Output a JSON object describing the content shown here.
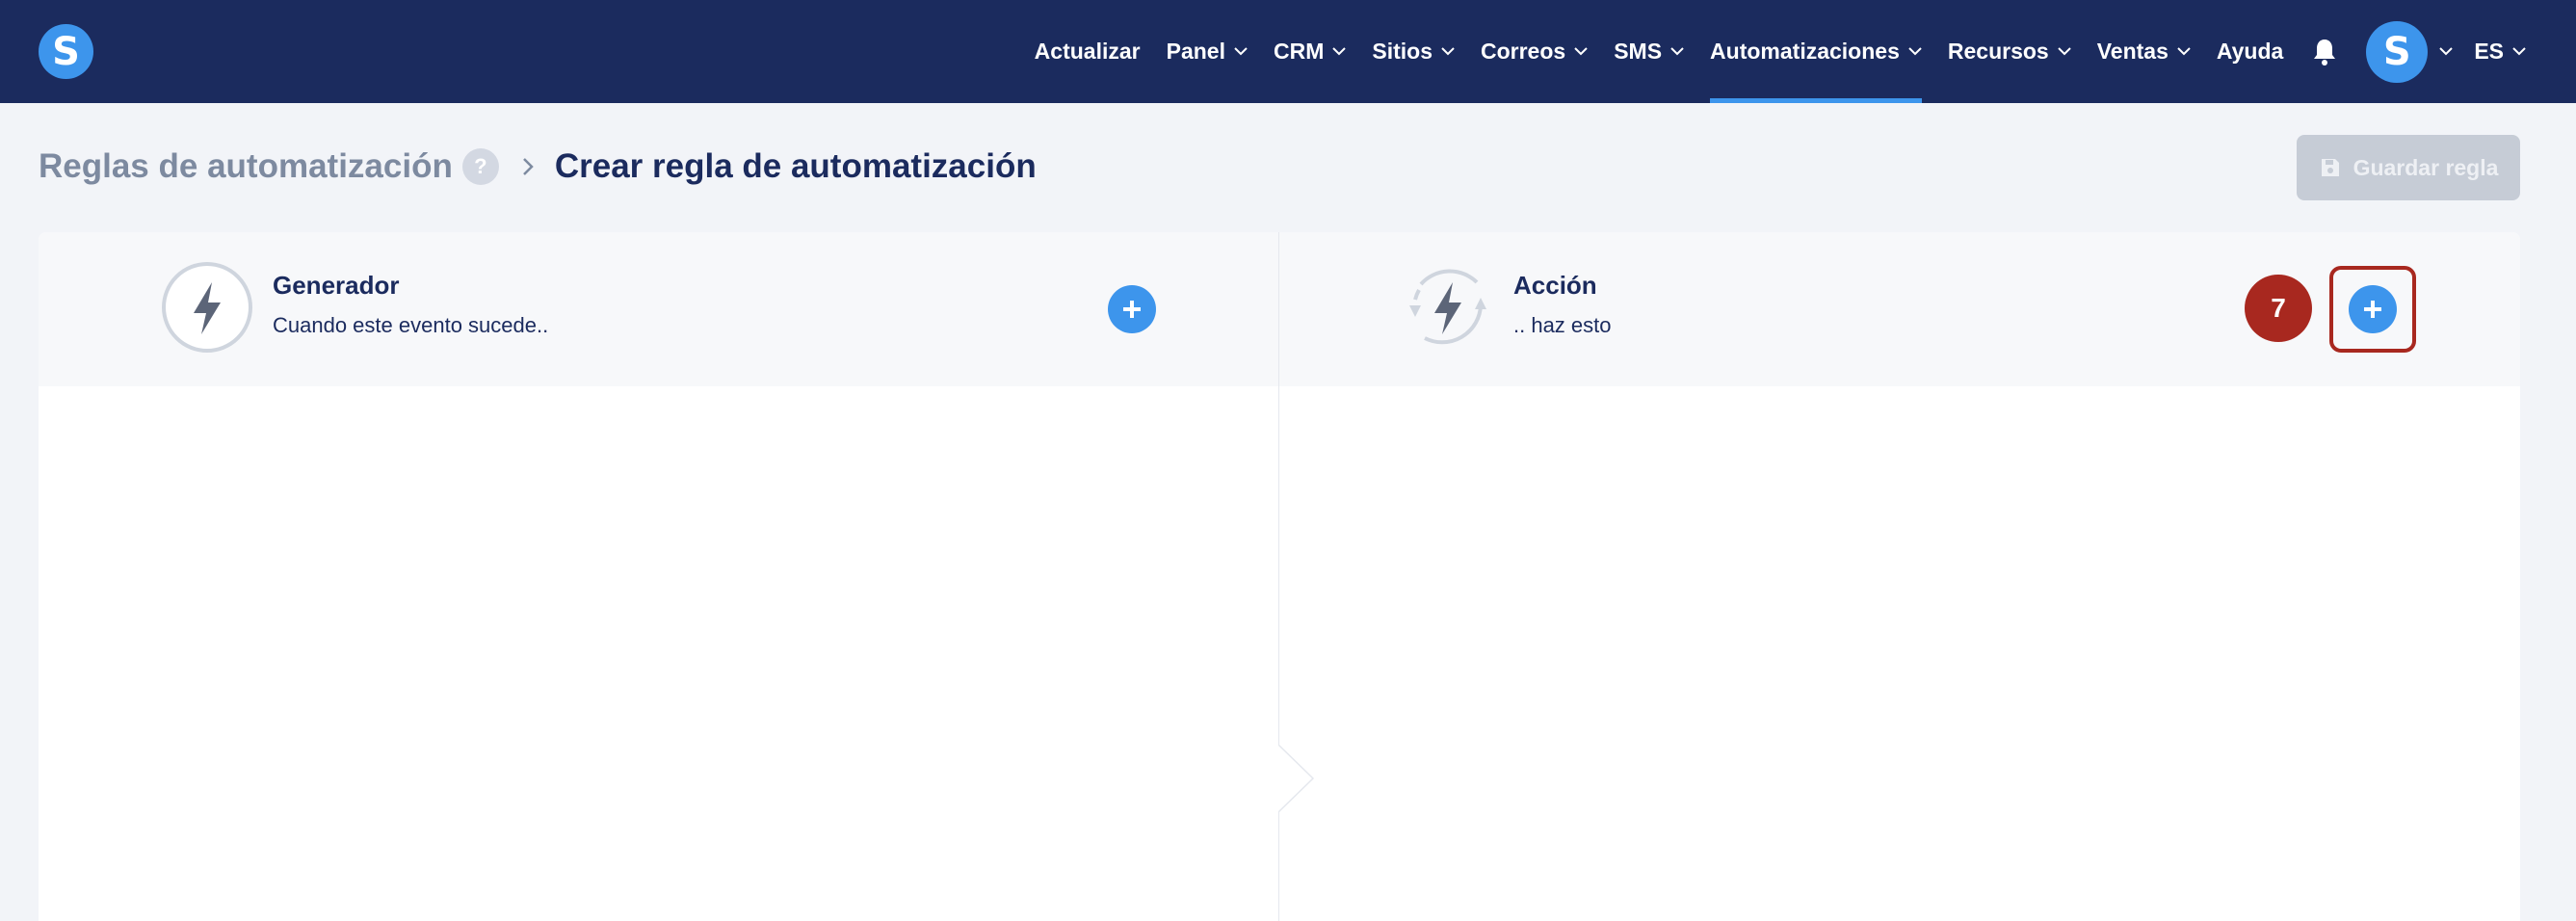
{
  "app": {
    "logo_letter": "S",
    "colors": {
      "nav_bg": "#1b2b5e",
      "accent": "#3d95ec",
      "page_bg": "#f2f4f8",
      "highlight": "#a8281f"
    }
  },
  "nav": {
    "items": [
      {
        "label": "Actualizar",
        "dropdown": false
      },
      {
        "label": "Panel",
        "dropdown": true
      },
      {
        "label": "CRM",
        "dropdown": true
      },
      {
        "label": "Sitios",
        "dropdown": true
      },
      {
        "label": "Correos",
        "dropdown": true
      },
      {
        "label": "SMS",
        "dropdown": true
      },
      {
        "label": "Automatizaciones",
        "dropdown": true,
        "active": true
      },
      {
        "label": "Recursos",
        "dropdown": true
      },
      {
        "label": "Ventas",
        "dropdown": true
      },
      {
        "label": "Ayuda",
        "dropdown": false
      }
    ],
    "notifications_icon": "bell-icon",
    "avatar_letter": "S",
    "language": "ES"
  },
  "header": {
    "breadcrumb_parent": "Reglas de automatización",
    "help_label": "?",
    "title": "Crear regla de automatización",
    "save_label": "Guardar regla",
    "save_icon": "floppy-disk-icon"
  },
  "trigger": {
    "title": "Generador",
    "subtitle": "Cuando este evento sucede..",
    "icon": "lightning-icon"
  },
  "action": {
    "title": "Acción",
    "subtitle": ".. haz esto",
    "icon": "lightning-cycle-icon"
  },
  "annotation": {
    "step_number": "7"
  }
}
